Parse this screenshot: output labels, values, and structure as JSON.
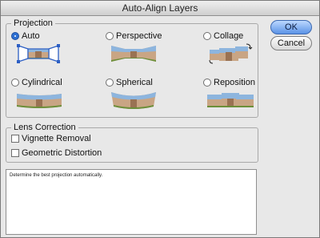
{
  "window": {
    "title": "Auto-Align Layers"
  },
  "projection": {
    "label": "Projection",
    "options": [
      {
        "label": "Auto",
        "selected": true
      },
      {
        "label": "Perspective",
        "selected": false
      },
      {
        "label": "Collage",
        "selected": false
      },
      {
        "label": "Cylindrical",
        "selected": false
      },
      {
        "label": "Spherical",
        "selected": false
      },
      {
        "label": "Reposition",
        "selected": false
      }
    ]
  },
  "lens_correction": {
    "label": "Lens Correction",
    "vignette_label": "Vignette Removal",
    "vignette_checked": false,
    "geometric_label": "Geometric Distortion",
    "geometric_checked": false
  },
  "description": {
    "text": "Determine the best projection automatically."
  },
  "buttons": {
    "ok": "OK",
    "cancel": "Cancel"
  },
  "colors": {
    "default_button": "#5b93e6",
    "radio_selected": "#2d6fd2",
    "window_bg": "#e8e8e8"
  }
}
